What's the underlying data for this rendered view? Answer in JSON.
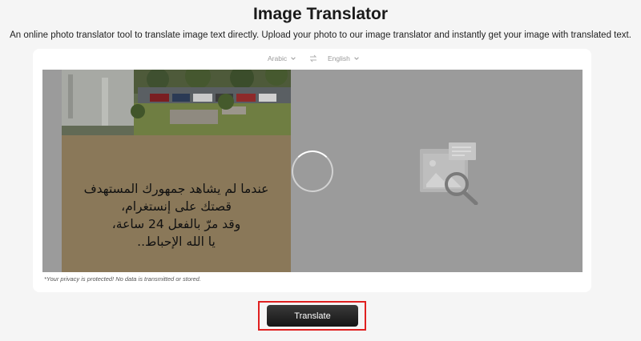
{
  "header": {
    "title": "Image Translator",
    "subtitle": "An online photo translator tool to translate image text directly. Upload your photo to our image translator and instantly get your image with translated text."
  },
  "languages": {
    "source": "Arabic",
    "target": "English",
    "dropdown_icon": "chevron-down-icon",
    "swap_icon": "swap-icon"
  },
  "image": {
    "arabic_lines": [
      "عندما لم يشاهد جمهورك المستهدف",
      "قصتك على إنستغرام،",
      "وقد مرّ بالفعل 24 ساعة،",
      "يا الله الإحباط.."
    ]
  },
  "result_panel": {
    "state": "loading",
    "icon": "image-search-placeholder-icon"
  },
  "privacy_note": "*Your privacy is protected! No data is transmitted or stored.",
  "action": {
    "translate_label": "Translate"
  },
  "colors": {
    "highlight": "#e02020",
    "button": "#1f1f1f",
    "work_area": "#9b9b9b",
    "photo_caption_bg": "#8a7859"
  }
}
